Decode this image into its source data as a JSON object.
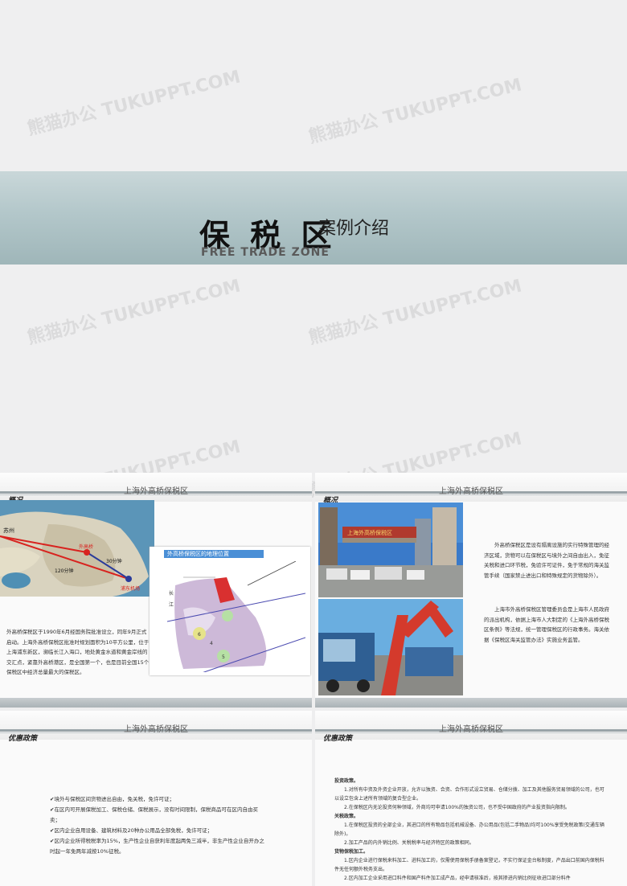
{
  "cover": {
    "title": "保 税 区",
    "subtitle": "案例介绍",
    "english": "FREE TRADE ZONE",
    "watermark": "熊猫办公 TUKUPPT.COM"
  },
  "slide1": {
    "header": "上海外高桥保税区",
    "tag": "概况",
    "map_label_city": "苏州",
    "map_label_route1": "30分钟",
    "map_label_route2": "120分钟",
    "map_label_a": "外高桥",
    "map_label_b": "浦东机场",
    "inset_title": "外高桥保税区的地理位置",
    "body": "外高桥保税区于1990年6月经国务院批准设立，同年9月正式启动。上海外高桥保税区批准时规划面积为10平方公里，位于上海浦东新区，濒临长江入海口，地处黄金水道和黄金岸线的交汇点，紧靠外高桥港区，是全国第一个，也是目前全国15个保税区中经济总量最大的保税区。"
  },
  "slide2": {
    "header": "上海外高桥保税区",
    "tag": "概况",
    "gate_sign": "上海外高桥保税区",
    "para1": "外高桥保税区是设有隔离设施的实行特殊管理的经济区域，货物可以在保税区与境外之间自由出入，免征关税和进口环节税，免验许可证件，免于常规的海关监管手续（国家禁止进出口和特殊规定的货物除外）。",
    "para2": "上海市外高桥保税区管理委员会是上海市人民政府的派出机构，依据上海市人大制定的《上海外高桥保税区条例》等法规，统一管理保税区的行政事务。海关依据《保税区海关监管办法》实施业务监管。"
  },
  "slide3": {
    "header": "上海外高桥保税区",
    "tag": "优惠政策",
    "items": [
      "✔境外与保税区间货物进出自由，免关税，免许可证；",
      "✔在区内可开展保税加工、保税仓储、保税展示，没有时间限制，保税商品可在区内自由买卖；",
      "✔区内企业自用设备、建筑材料及20种办公用品全部免税，免许可证；",
      "✔区内企业所得税税率为15%，生产性企业自获利年度起两免三减半，非生产性企业自开办之时起一年免两年减按10%征税。"
    ]
  },
  "slide4": {
    "header": "上海外高桥保税区",
    "tag": "优惠政策",
    "h_invest": "投资政策。",
    "invest1": "1.对所有中资及外资企业开放，允许以独资、合资、合作形式设立贸易、仓储分拨、加工及其他服务贸易领域的公司，也可以设立包含上述所有领域的复合型企业。",
    "invest2": "2.在保税区内无论投资何种领域，外商均可申请100%的独资公司，也不受中国政府的产业投资指向限制。",
    "h_tariff": "关税政策。",
    "tariff1": "1.在保税区投资的全部企业，其进口的所有物品包括机械设备、办公用品(包括二手物品)均可100%享受免税政策(交通车辆除外)。",
    "tariff2": "2.加工产品的内外销比例、关税税率与经济特区的政策相同。",
    "h_goods": "货物保税加工。",
    "goods1": "1.区内企业进行保税来料加工、进料加工的，仅需使用保税手册备案登记，不实行保证金台帐制度，产品出口前国内保税料件无任何额外税务支出。",
    "goods2": "2.区内加工企业采用进口料件和国产料件加工成产品，经申请核准后，按其掺进内销比例征收进口部分料件"
  },
  "colors": {
    "band": "#b3c7ca",
    "route_red": "#d8231f",
    "route_blue": "#2a3b9a",
    "zone_red": "#d93030",
    "header_rule": "#9aa4a8"
  }
}
